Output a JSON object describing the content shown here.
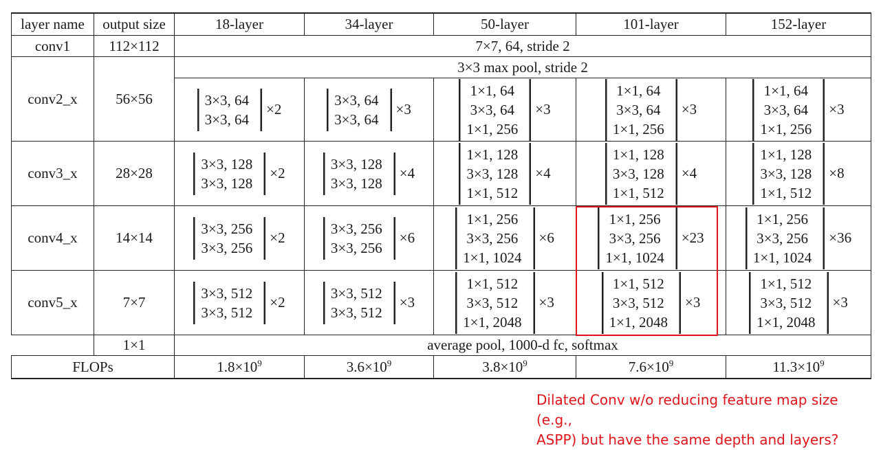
{
  "table": {
    "header": {
      "layer_name": "layer name",
      "output_size": "output size",
      "cols": [
        "18-layer",
        "34-layer",
        "50-layer",
        "101-layer",
        "152-layer"
      ]
    },
    "conv1": {
      "name": "conv1",
      "size": "112×112",
      "spec": "7×7, 64, stride 2"
    },
    "conv2": {
      "name": "conv2_x",
      "size": "56×56",
      "pool": "3×3 max pool, stride 2",
      "blocks": [
        {
          "lines": [
            "3×3, 64",
            "3×3, 64"
          ],
          "mult": "×2"
        },
        {
          "lines": [
            "3×3, 64",
            "3×3, 64"
          ],
          "mult": "×3"
        },
        {
          "lines": [
            "1×1, 64",
            "3×3, 64",
            "1×1, 256"
          ],
          "mult": "×3"
        },
        {
          "lines": [
            "1×1, 64",
            "3×3, 64",
            "1×1, 256"
          ],
          "mult": "×3"
        },
        {
          "lines": [
            "1×1, 64",
            "3×3, 64",
            "1×1, 256"
          ],
          "mult": "×3"
        }
      ]
    },
    "conv3": {
      "name": "conv3_x",
      "size": "28×28",
      "blocks": [
        {
          "lines": [
            "3×3, 128",
            "3×3, 128"
          ],
          "mult": "×2"
        },
        {
          "lines": [
            "3×3, 128",
            "3×3, 128"
          ],
          "mult": "×4"
        },
        {
          "lines": [
            "1×1, 128",
            "3×3, 128",
            "1×1, 512"
          ],
          "mult": "×4"
        },
        {
          "lines": [
            "1×1, 128",
            "3×3, 128",
            "1×1, 512"
          ],
          "mult": "×4"
        },
        {
          "lines": [
            "1×1, 128",
            "3×3, 128",
            "1×1, 512"
          ],
          "mult": "×8"
        }
      ]
    },
    "conv4": {
      "name": "conv4_x",
      "size": "14×14",
      "blocks": [
        {
          "lines": [
            "3×3, 256",
            "3×3, 256"
          ],
          "mult": "×2"
        },
        {
          "lines": [
            "3×3, 256",
            "3×3, 256"
          ],
          "mult": "×6"
        },
        {
          "lines": [
            "1×1, 256",
            "3×3, 256",
            "1×1, 1024"
          ],
          "mult": "×6"
        },
        {
          "lines": [
            "1×1, 256",
            "3×3, 256",
            "1×1, 1024"
          ],
          "mult": "×23"
        },
        {
          "lines": [
            "1×1, 256",
            "3×3, 256",
            "1×1, 1024"
          ],
          "mult": "×36"
        }
      ]
    },
    "conv5": {
      "name": "conv5_x",
      "size": "7×7",
      "blocks": [
        {
          "lines": [
            "3×3, 512",
            "3×3, 512"
          ],
          "mult": "×2"
        },
        {
          "lines": [
            "3×3, 512",
            "3×3, 512"
          ],
          "mult": "×3"
        },
        {
          "lines": [
            "1×1, 512",
            "3×3, 512",
            "1×1, 2048"
          ],
          "mult": "×3"
        },
        {
          "lines": [
            "1×1, 512",
            "3×3, 512",
            "1×1, 2048"
          ],
          "mult": "×3"
        },
        {
          "lines": [
            "1×1, 512",
            "3×3, 512",
            "1×1, 2048"
          ],
          "mult": "×3"
        }
      ]
    },
    "final": {
      "size": "1×1",
      "spec": "average pool, 1000-d fc, softmax"
    },
    "flops": {
      "label": "FLOPs",
      "values": [
        {
          "mantissa": "1.8×10",
          "exp": "9"
        },
        {
          "mantissa": "3.6×10",
          "exp": "9"
        },
        {
          "mantissa": "3.8×10",
          "exp": "9"
        },
        {
          "mantissa": "7.6×10",
          "exp": "9"
        },
        {
          "mantissa": "11.3×10",
          "exp": "9"
        }
      ]
    }
  },
  "annotation": {
    "color": "#e0141b",
    "lines": [
      "Dilated Conv w/o reducing feature map size (e.g.,",
      "ASPP) but have the same depth and layers?"
    ]
  }
}
